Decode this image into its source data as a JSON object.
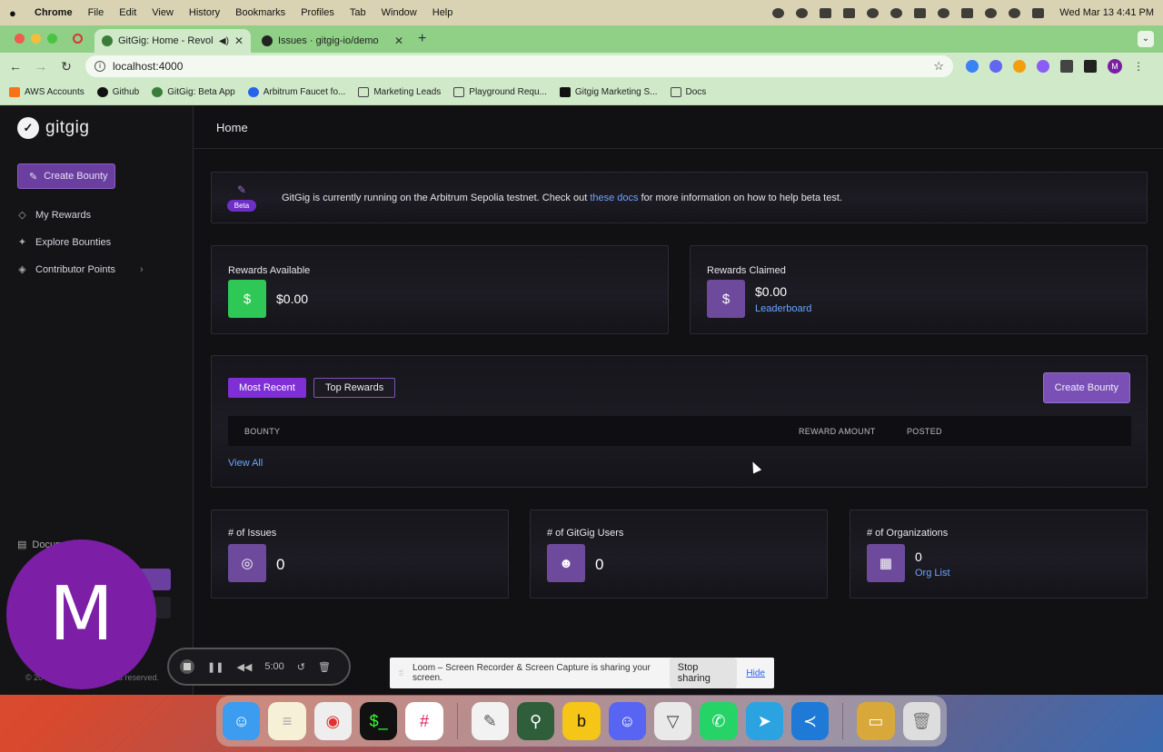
{
  "menubar": {
    "app": "Chrome",
    "items": [
      "File",
      "Edit",
      "View",
      "History",
      "Bookmarks",
      "Profiles",
      "Tab",
      "Window",
      "Help"
    ],
    "clock": "Wed Mar 13  4:41 PM"
  },
  "browser": {
    "tabs": [
      {
        "title": "GitGig: Home - Revolution"
      },
      {
        "title": "Issues · gitgig-io/demo"
      }
    ],
    "url": "localhost:4000",
    "profile_initial": "M",
    "bookmarks": [
      "AWS Accounts",
      "Github",
      "GitGig: Beta App",
      "Arbitrum Faucet fo...",
      "Marketing Leads",
      "Playground Requ...",
      "Gitgig Marketing S...",
      "Docs"
    ]
  },
  "sidebar": {
    "logo": "gitgig",
    "create_bounty": "Create Bounty",
    "items": [
      {
        "label": "My Rewards"
      },
      {
        "label": "Explore Bounties"
      },
      {
        "label": "Contributor Points"
      }
    ],
    "docs_label": "Docum",
    "footer_left": "© 20",
    "footer_right": "ghts reserved."
  },
  "header": {
    "title": "Home"
  },
  "banner": {
    "badge": "Beta",
    "text_before": "GitGig is currently running on the Arbitrum Sepolia testnet. Check out ",
    "link": "these docs",
    "text_after": " for more information on how to help beta test."
  },
  "stats_top": {
    "available": {
      "label": "Rewards Available",
      "value": "$0.00"
    },
    "claimed": {
      "label": "Rewards Claimed",
      "value": "$0.00",
      "link": "Leaderboard"
    }
  },
  "bounty_list": {
    "tabs": [
      "Most Recent",
      "Top Rewards"
    ],
    "create_button": "Create Bounty",
    "columns": [
      "BOUNTY",
      "REWARD AMOUNT",
      "POSTED"
    ],
    "rows": [],
    "view_all": "View All"
  },
  "stats_bottom": {
    "issues": {
      "label": "# of Issues",
      "value": "0"
    },
    "users": {
      "label": "# of GitGig Users",
      "value": "0"
    },
    "orgs": {
      "label": "# of Organizations",
      "value": "0",
      "link": "Org List"
    }
  },
  "overlays": {
    "avatar_initial": "M",
    "recorder_time": "5:00",
    "share_text": "Loom – Screen Recorder & Screen Capture is sharing your screen.",
    "stop_sharing": "Stop sharing",
    "hide": "Hide"
  },
  "colors": {
    "accent_purple": "#7e2fd6",
    "green": "#2fc755",
    "link_blue": "#6aa4ff"
  }
}
